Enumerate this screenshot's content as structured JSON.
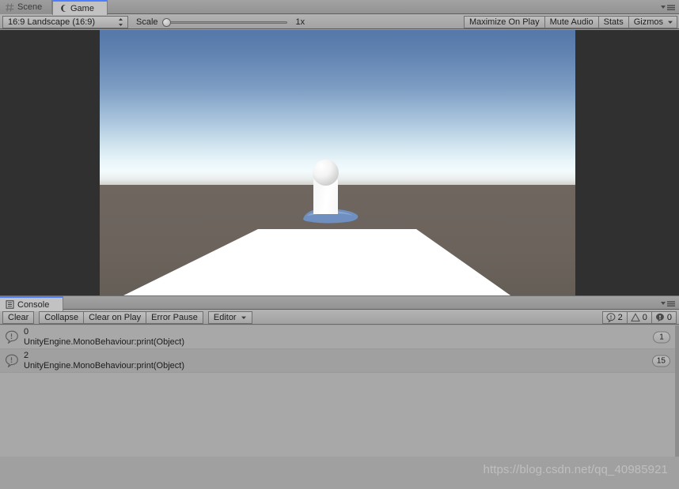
{
  "game_panel": {
    "tabs": [
      {
        "label": "Scene",
        "icon": "grid-icon",
        "active": false
      },
      {
        "label": "Game",
        "icon": "gamepad-icon",
        "active": true
      }
    ],
    "menu_icon": "panel-options-icon",
    "toolbar": {
      "aspect_ratio": "16:9 Landscape (16:9)",
      "aspect_icon": "updown-arrows-icon",
      "scale_label": "Scale",
      "scale_value": "1x",
      "maximize_on_play": "Maximize On Play",
      "mute_audio": "Mute Audio",
      "stats": "Stats",
      "gizmos": "Gizmos",
      "gizmos_arrow_icon": "chevron-down-icon"
    },
    "viewport": {
      "letterbox_color": "#303030",
      "sky_top_color": "#5577a9",
      "sky_horizon_color": "#f3fbfd",
      "ground_color": "#6b635d",
      "plane_color": "#ffffff",
      "object_color": "#f2f2f2",
      "blob_color": "#6f8fc0"
    }
  },
  "console_panel": {
    "tab": {
      "label": "Console",
      "icon": "console-icon"
    },
    "menu_icon": "panel-options-icon",
    "toolbar": {
      "clear": "Clear",
      "collapse": "Collapse",
      "clear_on_play": "Clear on Play",
      "error_pause": "Error Pause",
      "editor": "Editor",
      "editor_arrow_icon": "chevron-down-icon"
    },
    "counters": [
      {
        "icon": "info-icon",
        "count": "2"
      },
      {
        "icon": "warning-icon",
        "count": "0"
      },
      {
        "icon": "error-icon",
        "count": "0"
      }
    ],
    "log_entries": [
      {
        "icon": "info-icon",
        "message": "0",
        "stack": "UnityEngine.MonoBehaviour:print(Object)",
        "count": "1"
      },
      {
        "icon": "info-icon",
        "message": "2",
        "stack": "UnityEngine.MonoBehaviour:print(Object)",
        "count": "15"
      }
    ]
  },
  "watermark": {
    "text": "https://blog.csdn.net/qq_40985921"
  }
}
